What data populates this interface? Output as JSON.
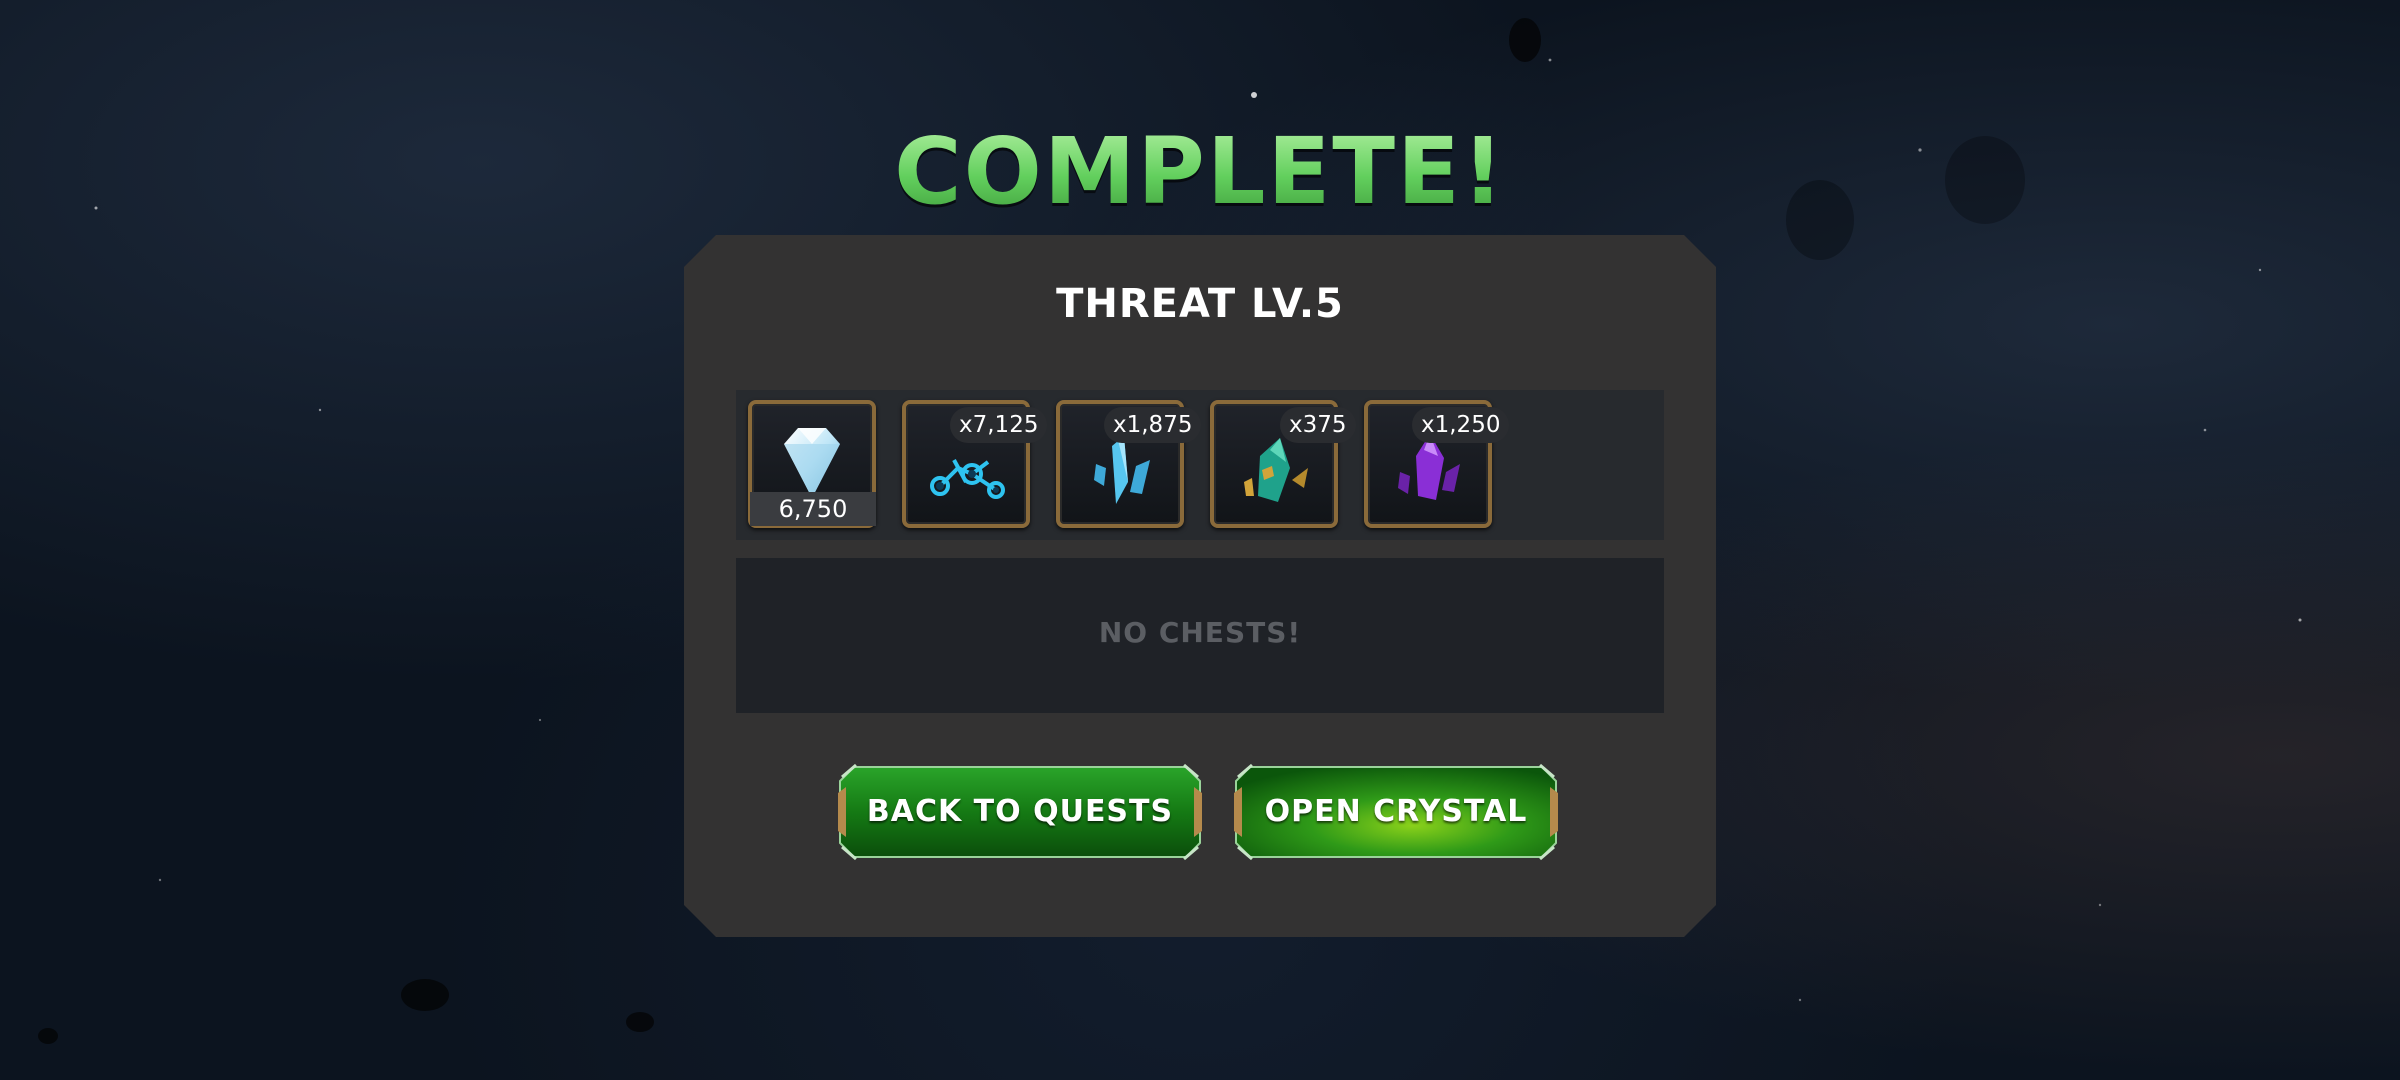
{
  "screen": {
    "title": "COMPLETE!",
    "title_color": "#6fd36a"
  },
  "panel": {
    "heading": "THREAT LV.5",
    "rewards": [
      {
        "icon": "diamond-gem-icon",
        "total": "6,750"
      },
      {
        "icon": "blue-catalyst-icon",
        "quantity": "x7,125"
      },
      {
        "icon": "cyan-shard-icon",
        "quantity": "x1,875"
      },
      {
        "icon": "teal-gold-shard-icon",
        "quantity": "x375"
      },
      {
        "icon": "purple-shard-icon",
        "quantity": "x1,250"
      }
    ],
    "chests_label": "NO CHESTS!"
  },
  "buttons": {
    "back": "BACK TO QUESTS",
    "open": "OPEN CRYSTAL",
    "color": "#1f8a1a"
  }
}
